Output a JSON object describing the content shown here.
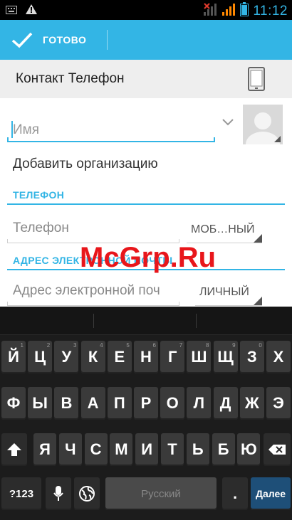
{
  "status_bar": {
    "time": "11:12",
    "icons": [
      "keyboard-icon",
      "warning-icon",
      "signal-no-icon",
      "signal-icon",
      "battery-icon"
    ]
  },
  "action_bar": {
    "done_label": "ГОТОВО",
    "done_icon": "checkmark-icon",
    "color": "#33b5e5"
  },
  "account": {
    "title": "Контакт Телефон",
    "icon": "phone-device-icon"
  },
  "form": {
    "name_placeholder": "Имя",
    "add_organization": "Добавить организацию",
    "phone_section": "ТЕЛЕФОН",
    "phone_placeholder": "Телефон",
    "phone_type": "МОБ…НЫЙ",
    "email_section": "АДРЕС ЭЛЕКТРОННОЙ ПОЧТЫ",
    "email_placeholder": "Адрес электронной поч",
    "email_type": "ЛИЧНЫЙ"
  },
  "watermark": "McGrp.Ru",
  "keyboard": {
    "row1": [
      {
        "label": "Й",
        "hint": "1"
      },
      {
        "label": "Ц",
        "hint": "2"
      },
      {
        "label": "У",
        "hint": "3"
      },
      {
        "label": "К",
        "hint": "4"
      },
      {
        "label": "Е",
        "hint": "5"
      },
      {
        "label": "Н",
        "hint": "6"
      },
      {
        "label": "Г",
        "hint": "7"
      },
      {
        "label": "Ш",
        "hint": "8"
      },
      {
        "label": "Щ",
        "hint": "9"
      },
      {
        "label": "З",
        "hint": "0"
      },
      {
        "label": "Х",
        "hint": ""
      }
    ],
    "row2": [
      "Ф",
      "Ы",
      "В",
      "А",
      "П",
      "Р",
      "О",
      "Л",
      "Д",
      "Ж",
      "Э"
    ],
    "row3": [
      "Я",
      "Ч",
      "С",
      "М",
      "И",
      "Т",
      "Ь",
      "Б",
      "Ю"
    ],
    "symbols_label": "?123",
    "space_label": "Русский",
    "period_label": ".",
    "enter_label": "Далее"
  }
}
